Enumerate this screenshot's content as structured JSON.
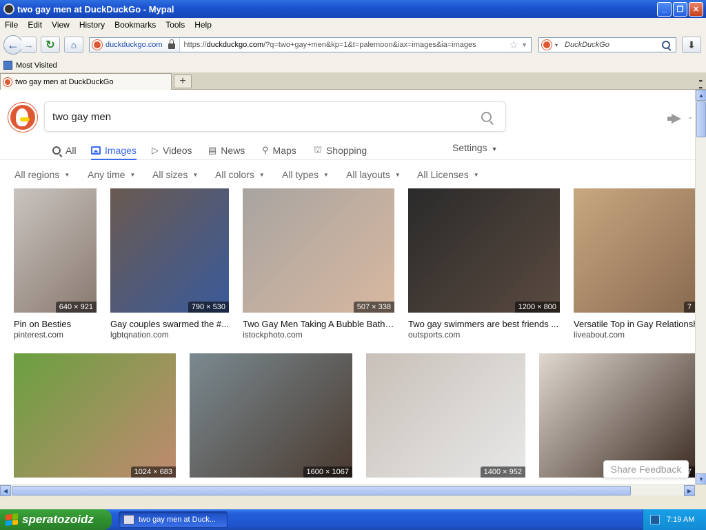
{
  "window": {
    "title": "two gay men at DuckDuckGo - Mypal"
  },
  "menu": [
    "File",
    "Edit",
    "View",
    "History",
    "Bookmarks",
    "Tools",
    "Help"
  ],
  "urlbar": {
    "identity": "duckduckgo.com",
    "url_prefix": "https://",
    "url_domain": "duckduckgo.com",
    "url_rest": "/?q=two+gay+men&kp=1&t=palemoon&iax=images&ia=images"
  },
  "searchbar": {
    "placeholder": "DuckDuckGo"
  },
  "bookmarks": {
    "most_visited": "Most Visited"
  },
  "tab": {
    "title": "two gay men at DuckDuckGo"
  },
  "ddg": {
    "query": "two gay men",
    "nav": [
      "All",
      "Images",
      "Videos",
      "News",
      "Maps",
      "Shopping"
    ],
    "active_nav": "Images",
    "settings": "Settings",
    "filters": [
      "All regions",
      "Any time",
      "All sizes",
      "All colors",
      "All types",
      "All layouts",
      "All Licenses"
    ]
  },
  "results_row1": [
    {
      "caption": "Pin on Besties",
      "source": "pinterest.com",
      "dims": "640 × 921",
      "colors": [
        "#c9c4bf",
        "#8a7a70"
      ]
    },
    {
      "caption": "Gay couples swarmed the #...",
      "source": "lgbtqnation.com",
      "dims": "790 × 530",
      "colors": [
        "#6a5a50",
        "#3a5a9a"
      ]
    },
    {
      "caption": "Two Gay Men Taking A Bubble Bath ...",
      "source": "istockphoto.com",
      "dims": "507 × 338",
      "colors": [
        "#a8a4a0",
        "#d8b8a0"
      ]
    },
    {
      "caption": "Two gay swimmers are best friends ...",
      "source": "outsports.com",
      "dims": "1200 × 800",
      "colors": [
        "#2a2a2a",
        "#5a4a40"
      ]
    },
    {
      "caption": "Versatile Top in Gay Relationship",
      "source": "liveabout.com",
      "dims": "7",
      "colors": [
        "#c8a880",
        "#8a6a50"
      ]
    }
  ],
  "results_row2": [
    {
      "dims": "1024 × 683",
      "colors": [
        "#6aa040",
        "#c08a70"
      ]
    },
    {
      "dims": "1600 × 1067",
      "colors": [
        "#7a8a90",
        "#4a3a30"
      ]
    },
    {
      "dims": "1400 × 952",
      "colors": [
        "#c8c0b8",
        "#e8e8e8"
      ]
    },
    {
      "dims": "7",
      "colors": [
        "#e0d8d0",
        "#3a2a20"
      ]
    }
  ],
  "feedback": "Share Feedback",
  "taskbar": {
    "start": "speratozoidz",
    "task": "two gay men at Duck...",
    "clock": "7:19 AM"
  }
}
